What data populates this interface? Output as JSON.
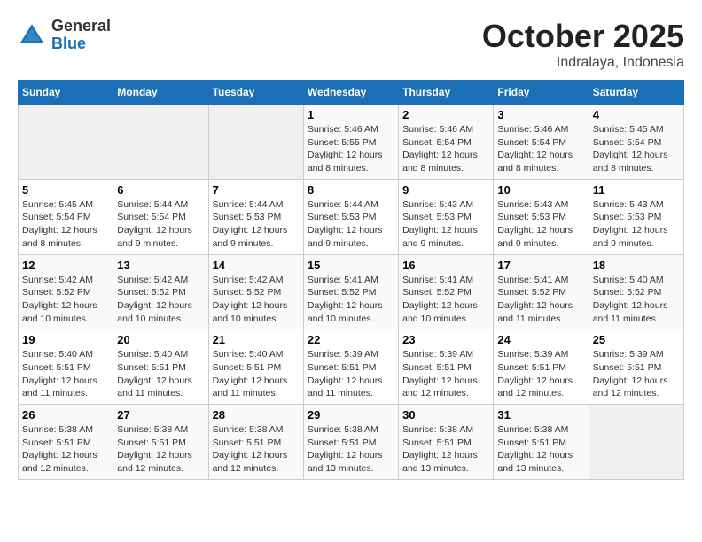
{
  "header": {
    "logo": {
      "general": "General",
      "blue": "Blue"
    },
    "month": "October 2025",
    "location": "Indralaya, Indonesia"
  },
  "weekdays": [
    "Sunday",
    "Monday",
    "Tuesday",
    "Wednesday",
    "Thursday",
    "Friday",
    "Saturday"
  ],
  "weeks": [
    [
      {
        "day": "",
        "info": ""
      },
      {
        "day": "",
        "info": ""
      },
      {
        "day": "",
        "info": ""
      },
      {
        "day": "1",
        "info": "Sunrise: 5:46 AM\nSunset: 5:55 PM\nDaylight: 12 hours\nand 8 minutes."
      },
      {
        "day": "2",
        "info": "Sunrise: 5:46 AM\nSunset: 5:54 PM\nDaylight: 12 hours\nand 8 minutes."
      },
      {
        "day": "3",
        "info": "Sunrise: 5:46 AM\nSunset: 5:54 PM\nDaylight: 12 hours\nand 8 minutes."
      },
      {
        "day": "4",
        "info": "Sunrise: 5:45 AM\nSunset: 5:54 PM\nDaylight: 12 hours\nand 8 minutes."
      }
    ],
    [
      {
        "day": "5",
        "info": "Sunrise: 5:45 AM\nSunset: 5:54 PM\nDaylight: 12 hours\nand 8 minutes."
      },
      {
        "day": "6",
        "info": "Sunrise: 5:44 AM\nSunset: 5:54 PM\nDaylight: 12 hours\nand 9 minutes."
      },
      {
        "day": "7",
        "info": "Sunrise: 5:44 AM\nSunset: 5:53 PM\nDaylight: 12 hours\nand 9 minutes."
      },
      {
        "day": "8",
        "info": "Sunrise: 5:44 AM\nSunset: 5:53 PM\nDaylight: 12 hours\nand 9 minutes."
      },
      {
        "day": "9",
        "info": "Sunrise: 5:43 AM\nSunset: 5:53 PM\nDaylight: 12 hours\nand 9 minutes."
      },
      {
        "day": "10",
        "info": "Sunrise: 5:43 AM\nSunset: 5:53 PM\nDaylight: 12 hours\nand 9 minutes."
      },
      {
        "day": "11",
        "info": "Sunrise: 5:43 AM\nSunset: 5:53 PM\nDaylight: 12 hours\nand 9 minutes."
      }
    ],
    [
      {
        "day": "12",
        "info": "Sunrise: 5:42 AM\nSunset: 5:52 PM\nDaylight: 12 hours\nand 10 minutes."
      },
      {
        "day": "13",
        "info": "Sunrise: 5:42 AM\nSunset: 5:52 PM\nDaylight: 12 hours\nand 10 minutes."
      },
      {
        "day": "14",
        "info": "Sunrise: 5:42 AM\nSunset: 5:52 PM\nDaylight: 12 hours\nand 10 minutes."
      },
      {
        "day": "15",
        "info": "Sunrise: 5:41 AM\nSunset: 5:52 PM\nDaylight: 12 hours\nand 10 minutes."
      },
      {
        "day": "16",
        "info": "Sunrise: 5:41 AM\nSunset: 5:52 PM\nDaylight: 12 hours\nand 10 minutes."
      },
      {
        "day": "17",
        "info": "Sunrise: 5:41 AM\nSunset: 5:52 PM\nDaylight: 12 hours\nand 11 minutes."
      },
      {
        "day": "18",
        "info": "Sunrise: 5:40 AM\nSunset: 5:52 PM\nDaylight: 12 hours\nand 11 minutes."
      }
    ],
    [
      {
        "day": "19",
        "info": "Sunrise: 5:40 AM\nSunset: 5:51 PM\nDaylight: 12 hours\nand 11 minutes."
      },
      {
        "day": "20",
        "info": "Sunrise: 5:40 AM\nSunset: 5:51 PM\nDaylight: 12 hours\nand 11 minutes."
      },
      {
        "day": "21",
        "info": "Sunrise: 5:40 AM\nSunset: 5:51 PM\nDaylight: 12 hours\nand 11 minutes."
      },
      {
        "day": "22",
        "info": "Sunrise: 5:39 AM\nSunset: 5:51 PM\nDaylight: 12 hours\nand 11 minutes."
      },
      {
        "day": "23",
        "info": "Sunrise: 5:39 AM\nSunset: 5:51 PM\nDaylight: 12 hours\nand 12 minutes."
      },
      {
        "day": "24",
        "info": "Sunrise: 5:39 AM\nSunset: 5:51 PM\nDaylight: 12 hours\nand 12 minutes."
      },
      {
        "day": "25",
        "info": "Sunrise: 5:39 AM\nSunset: 5:51 PM\nDaylight: 12 hours\nand 12 minutes."
      }
    ],
    [
      {
        "day": "26",
        "info": "Sunrise: 5:38 AM\nSunset: 5:51 PM\nDaylight: 12 hours\nand 12 minutes."
      },
      {
        "day": "27",
        "info": "Sunrise: 5:38 AM\nSunset: 5:51 PM\nDaylight: 12 hours\nand 12 minutes."
      },
      {
        "day": "28",
        "info": "Sunrise: 5:38 AM\nSunset: 5:51 PM\nDaylight: 12 hours\nand 12 minutes."
      },
      {
        "day": "29",
        "info": "Sunrise: 5:38 AM\nSunset: 5:51 PM\nDaylight: 12 hours\nand 13 minutes."
      },
      {
        "day": "30",
        "info": "Sunrise: 5:38 AM\nSunset: 5:51 PM\nDaylight: 12 hours\nand 13 minutes."
      },
      {
        "day": "31",
        "info": "Sunrise: 5:38 AM\nSunset: 5:51 PM\nDaylight: 12 hours\nand 13 minutes."
      },
      {
        "day": "",
        "info": ""
      }
    ]
  ]
}
